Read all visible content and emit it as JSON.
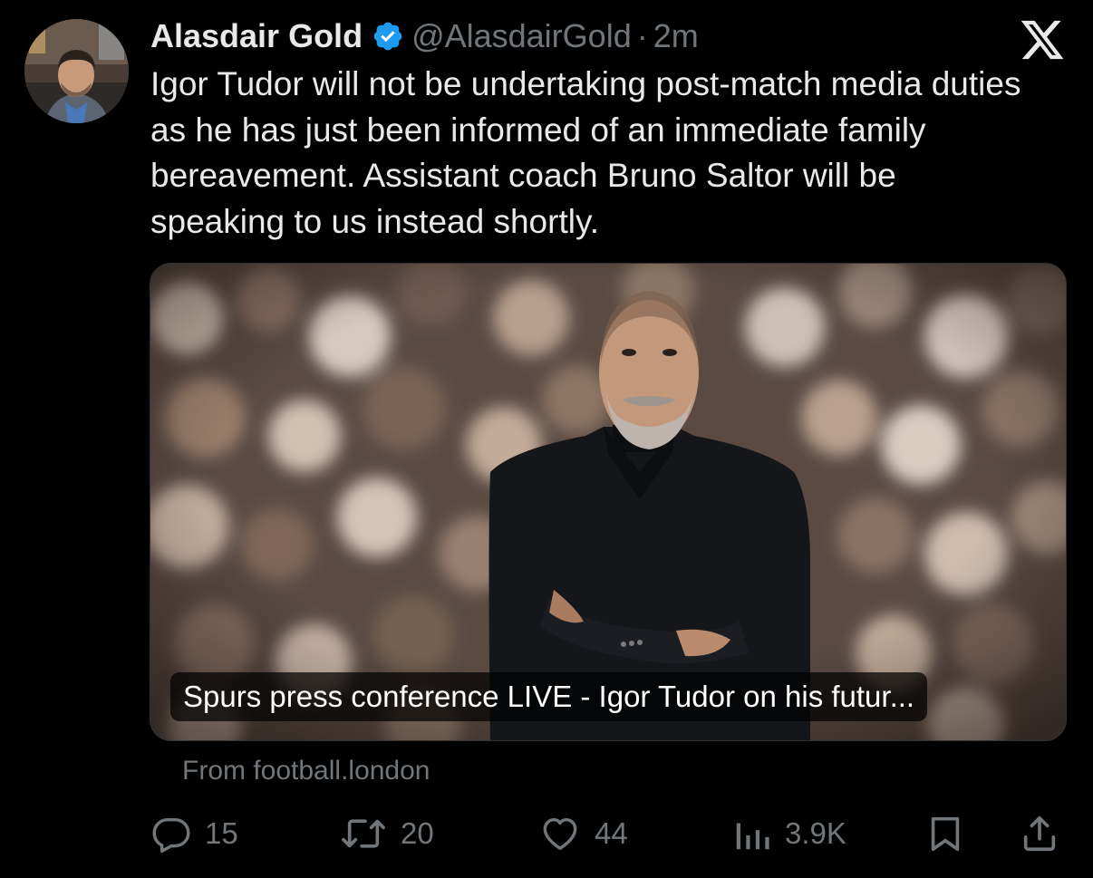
{
  "author": {
    "display_name": "Alasdair Gold",
    "handle": "@AlasdairGold",
    "separator": "·",
    "time": "2m",
    "verified": true,
    "avatar_icon": "profile-photo"
  },
  "platform_logo": "x-logo-icon",
  "tweet": {
    "text": "Igor Tudor will not be undertaking post-match media duties as he has just been informed of an immediate family bereavement. Assistant coach Bruno Saltor will be speaking to us instead shortly."
  },
  "link_card": {
    "title": "Spurs press conference LIVE - Igor Tudor on his futur...",
    "source": "From football.london"
  },
  "actions": {
    "replies": "15",
    "reposts": "20",
    "likes": "44",
    "views": "3.9K"
  },
  "colors": {
    "background": "#000000",
    "primary_text": "#e7e9ea",
    "secondary_text": "#71767b",
    "verified_blue": "#1d9bf0"
  }
}
